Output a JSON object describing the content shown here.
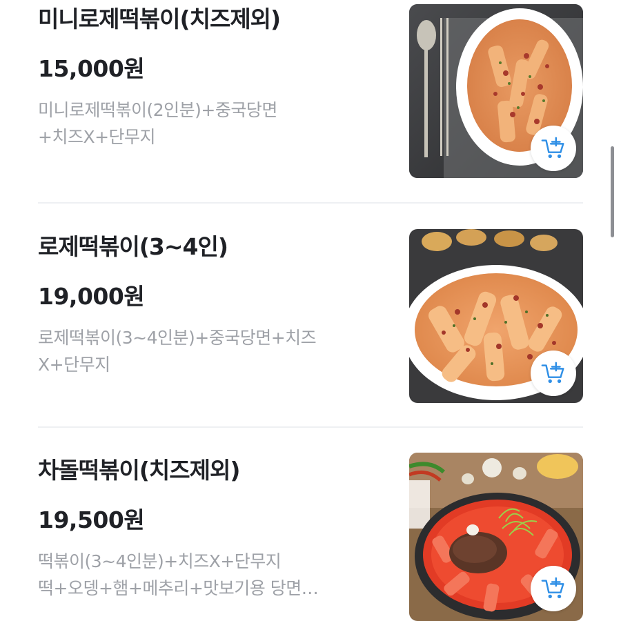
{
  "items": [
    {
      "name": "미니로제떡볶이(치즈제외)",
      "price": "15,000원",
      "desc_lines": [
        "미니로제떡볶이(2인분)+중국당면",
        "+치즈X+단무지"
      ],
      "image_alt": "rose-tteokbokki-plate-photo",
      "cart_icon": "add-to-cart-icon"
    },
    {
      "name": "로제떡볶이(3~4인)",
      "price": "19,000원",
      "desc_lines": [
        "로제떡볶이(3~4인분)+중국당면+치즈",
        "X+단무지"
      ],
      "image_alt": "rose-tteokbokki-bowl-photo",
      "cart_icon": "add-to-cart-icon"
    },
    {
      "name": "차돌떡볶이(치즈제외)",
      "price": "19,500원",
      "desc_lines": [
        "떡볶이(3~4인분)+치즈X+단무지",
        "떡+오뎅+햄+메추리+맛보기용 당면…"
      ],
      "image_alt": "chadol-tteokbokki-pan-photo",
      "cart_icon": "add-to-cart-icon"
    }
  ],
  "colors": {
    "title": "#1f2126",
    "desc": "#9ea1a7",
    "accent": "#2f8fe6",
    "divider": "#eef0f3"
  }
}
